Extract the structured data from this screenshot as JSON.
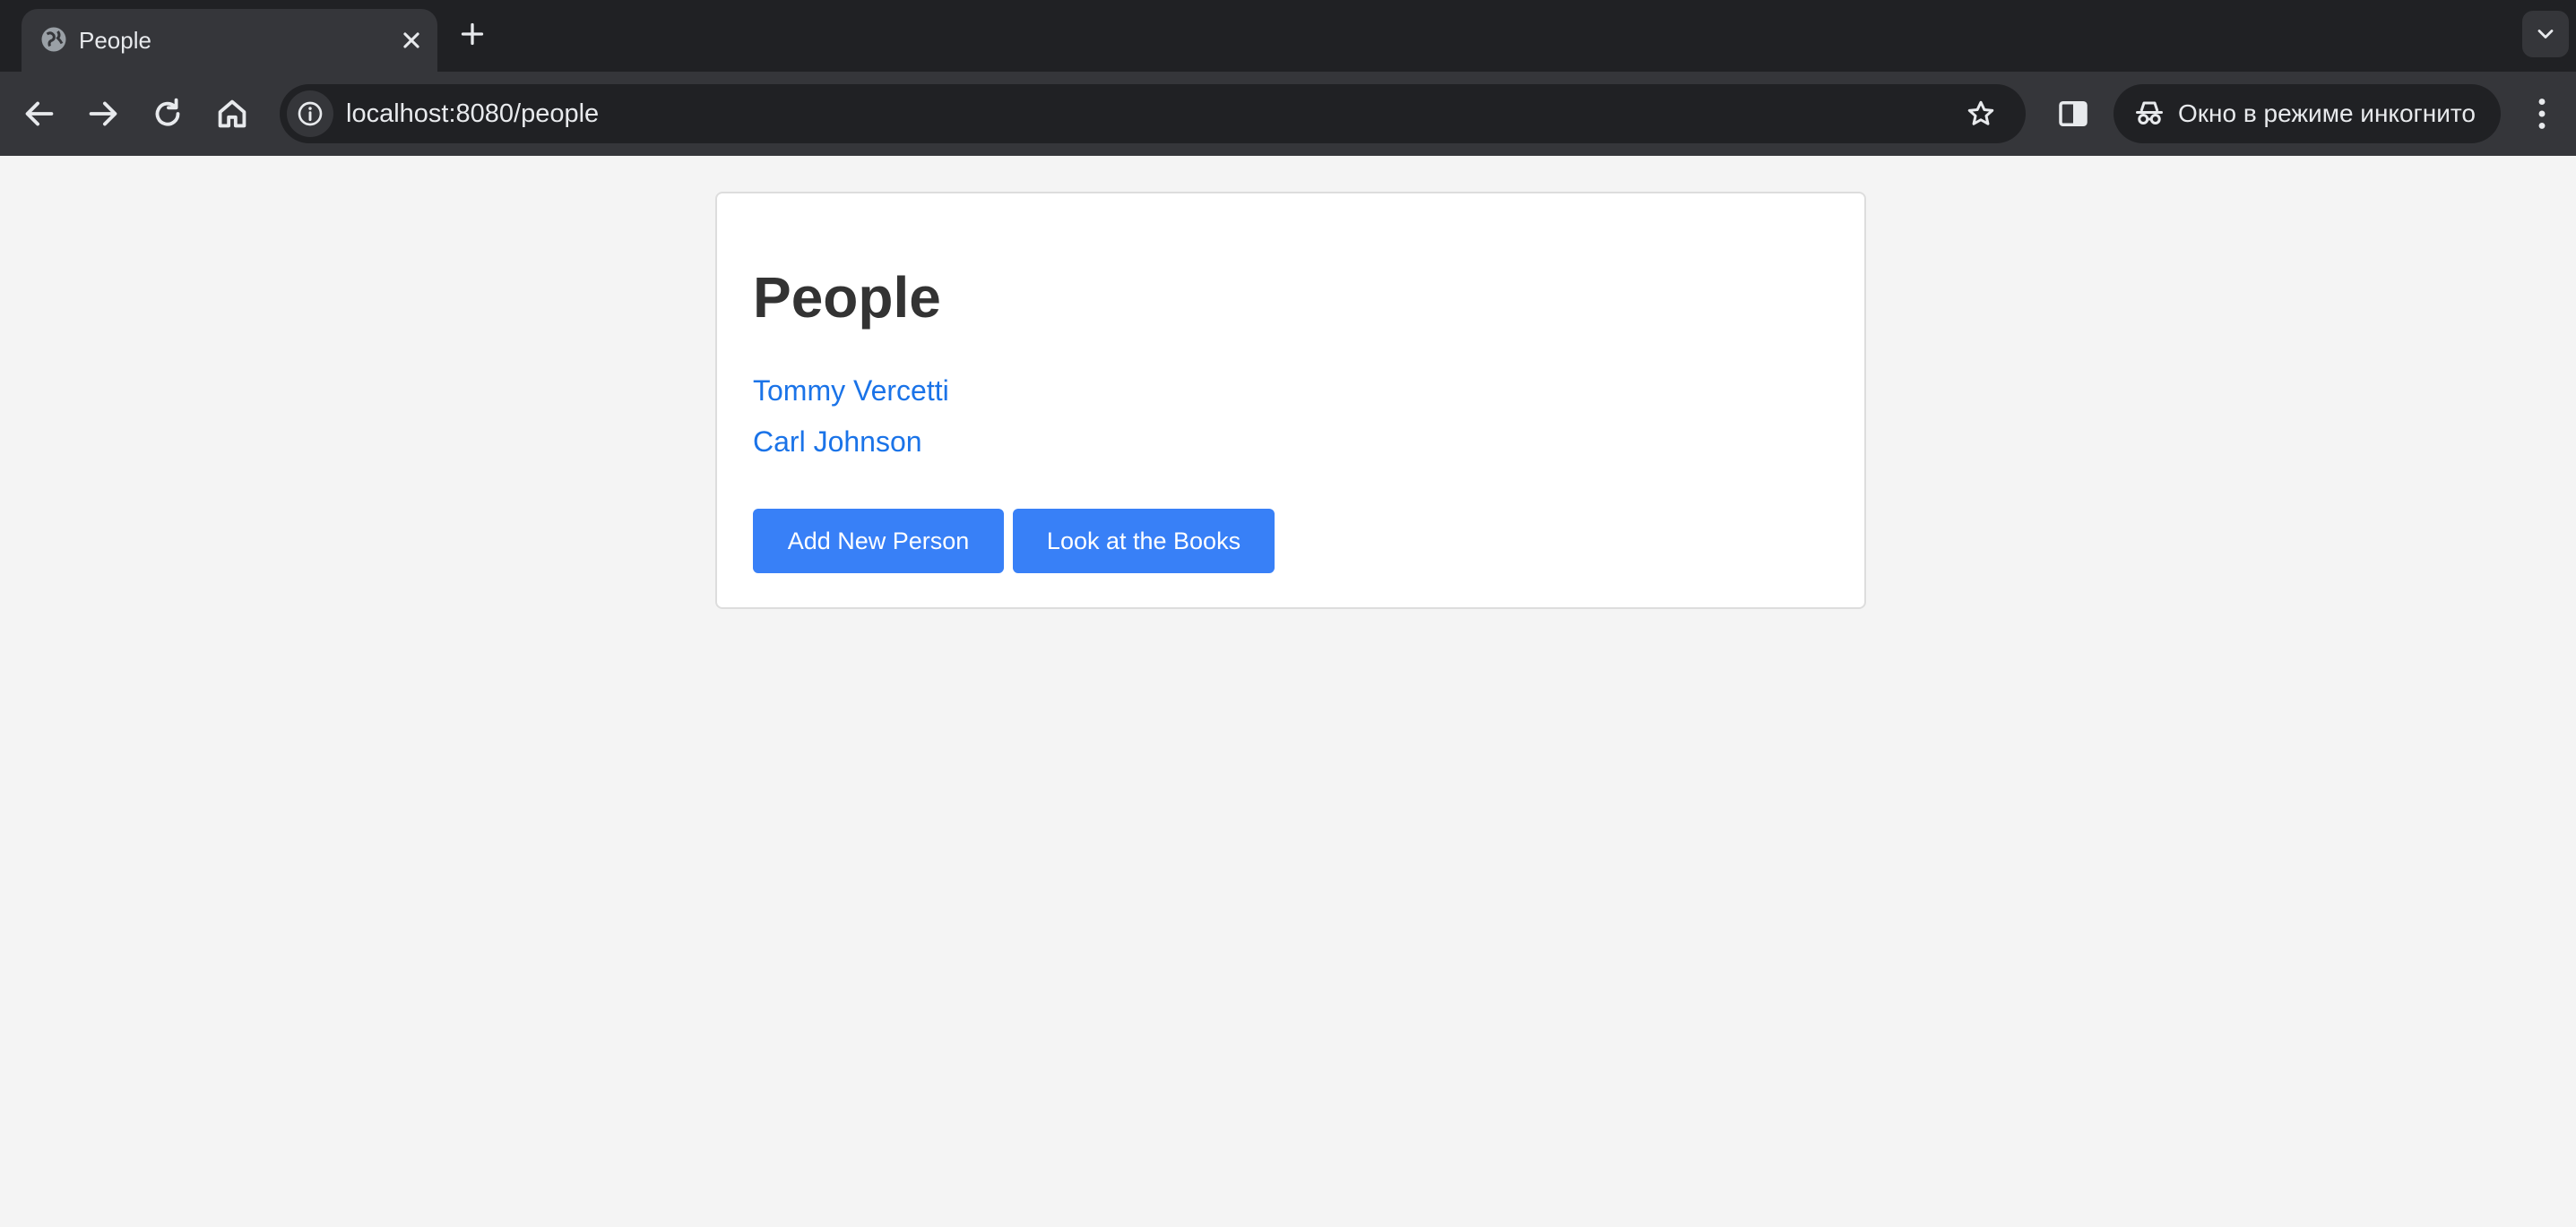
{
  "browser": {
    "tab_title": "People",
    "url": "localhost:8080/people",
    "incognito_label": "Окно в режиме инкогнито"
  },
  "page": {
    "heading": "People",
    "people": [
      "Tommy Vercetti",
      "Carl Johnson"
    ],
    "add_button_label": "Add New Person",
    "books_button_label": "Look at the Books"
  },
  "colors": {
    "link": "#1a73e8",
    "button": "#3880f7",
    "page_background": "#f4f4f4"
  }
}
